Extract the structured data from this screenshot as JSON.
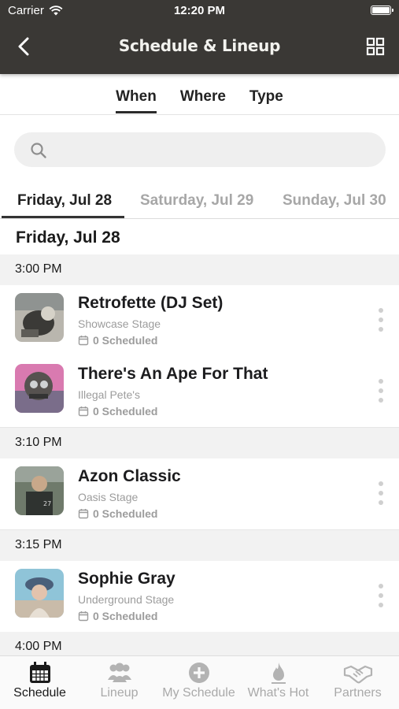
{
  "status_bar": {
    "carrier": "Carrier",
    "time": "12:20 PM"
  },
  "header": {
    "title": "Schedule & Lineup",
    "back_icon": "chevron-left-icon",
    "view_icon": "grid-icon"
  },
  "filters": [
    {
      "label": "When",
      "active": true
    },
    {
      "label": "Where",
      "active": false
    },
    {
      "label": "Type",
      "active": false
    }
  ],
  "search": {
    "placeholder": "",
    "value": ""
  },
  "days": [
    {
      "label": "Friday, Jul 28",
      "active": true
    },
    {
      "label": "Saturday, Jul 29",
      "active": false
    },
    {
      "label": "Sunday, Jul 30",
      "active": false
    }
  ],
  "section_title": "Friday, Jul 28",
  "time_slots": [
    "3:00 PM",
    "3:10 PM",
    "3:15 PM",
    "4:00 PM"
  ],
  "events": [
    {
      "title": "Retrofette (DJ Set)",
      "stage": "Showcase Stage",
      "scheduled": "0 Scheduled"
    },
    {
      "title": "There's An Ape For That",
      "stage": "Illegal Pete's",
      "scheduled": "0 Scheduled"
    },
    {
      "title": "Azon Classic",
      "stage": "Oasis Stage",
      "scheduled": "0 Scheduled"
    },
    {
      "title": "Sophie Gray",
      "stage": "Underground Stage",
      "scheduled": "0 Scheduled"
    }
  ],
  "tabbar": [
    {
      "label": "Schedule",
      "icon": "calendar-icon",
      "active": true
    },
    {
      "label": "Lineup",
      "icon": "people-icon",
      "active": false
    },
    {
      "label": "My Schedule",
      "icon": "plus-circle-icon",
      "active": false
    },
    {
      "label": "What's Hot",
      "icon": "flame-icon",
      "active": false
    },
    {
      "label": "Partners",
      "icon": "handshake-icon",
      "active": false
    }
  ],
  "colors": {
    "header_bg": "#3a3835",
    "active_text": "#1a1a1a",
    "inactive_text": "#a9a9a9",
    "time_row_bg": "#f2f2f2"
  }
}
